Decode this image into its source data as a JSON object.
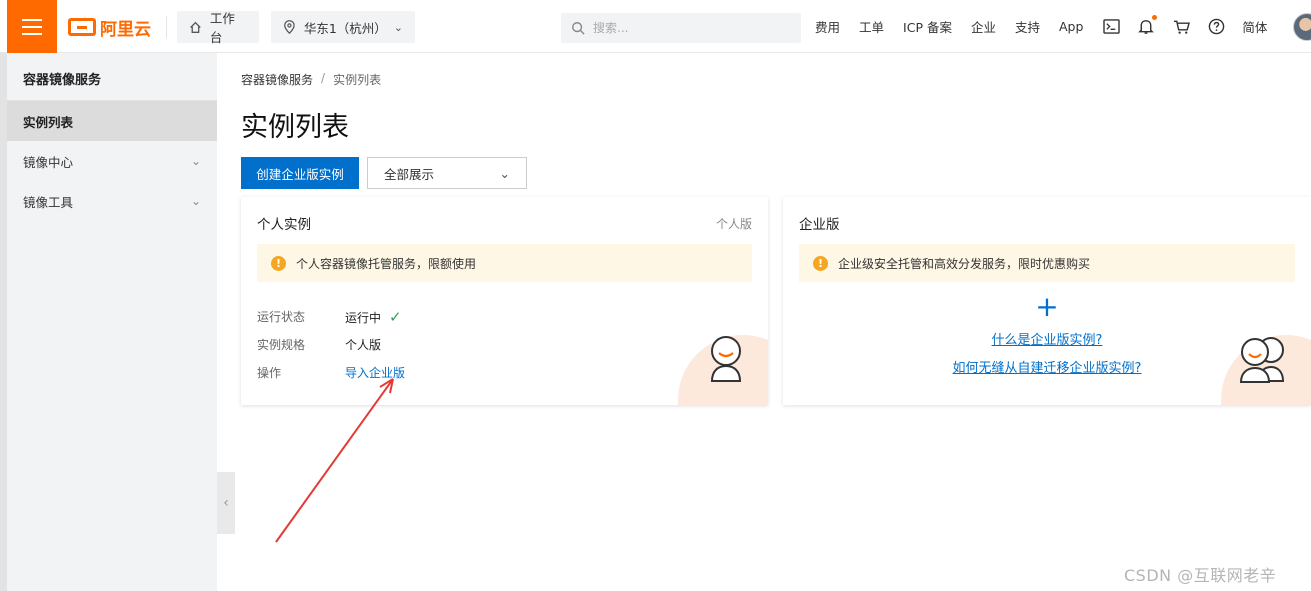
{
  "topbar": {
    "brand": "阿里云",
    "workbench": "工作台",
    "region": "华东1（杭州）",
    "search_placeholder": "搜索...",
    "nav": [
      "费用",
      "工单",
      "ICP 备案",
      "企业",
      "支持",
      "App"
    ],
    "language": "简体"
  },
  "sidebar": {
    "title": "容器镜像服务",
    "items": [
      {
        "label": "实例列表"
      },
      {
        "label": "镜像中心"
      },
      {
        "label": "镜像工具"
      }
    ]
  },
  "main": {
    "breadcrumb": [
      "容器镜像服务",
      "实例列表"
    ],
    "breadcrumb_sep": "/",
    "title": "实例列表",
    "create_button": "创建企业版实例",
    "filter_select": "全部展示"
  },
  "personal_card": {
    "title": "个人实例",
    "tag": "个人版",
    "notice": "个人容器镜像托管服务，限额使用",
    "rows": [
      {
        "key": "运行状态",
        "value": "运行中"
      },
      {
        "key": "实例规格",
        "value": "个人版"
      },
      {
        "key": "操作",
        "value": "导入企业版"
      }
    ]
  },
  "enterprise_card": {
    "title": "企业版",
    "notice": "企业级安全托管和高效分发服务，限时优惠购买",
    "plus": "+",
    "link1": "什么是企业版实例?",
    "link2": "如何无缝从自建迁移企业版实例?"
  },
  "watermark": "CSDN @互联网老辛",
  "colors": {
    "accent": "#ff6a00",
    "primary": "#0070cc",
    "annotation_arrow": "#e53935"
  }
}
